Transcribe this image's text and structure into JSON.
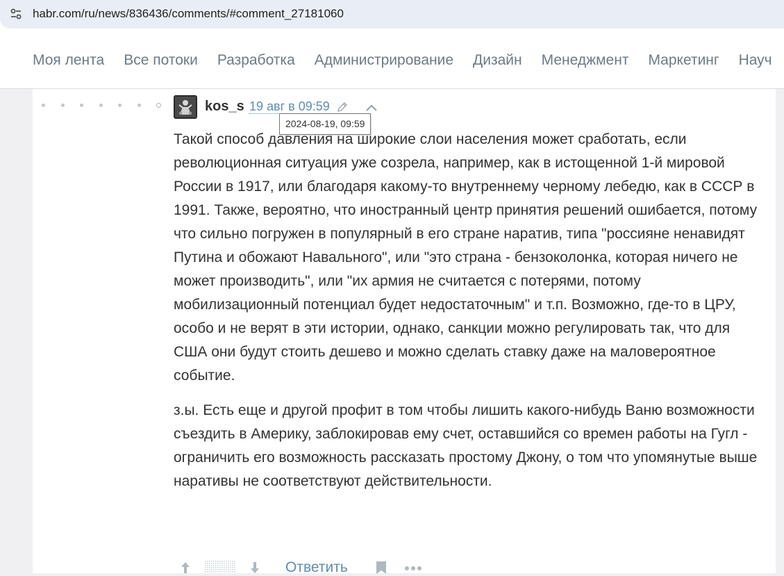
{
  "browser": {
    "url": "habr.com/ru/news/836436/comments/#comment_27181060",
    "site_info_icon": "tune-icon"
  },
  "nav": {
    "items": [
      {
        "label": "Моя лента"
      },
      {
        "label": "Все потоки"
      },
      {
        "label": "Разработка"
      },
      {
        "label": "Администрирование"
      },
      {
        "label": "Дизайн"
      },
      {
        "label": "Менеджмент"
      },
      {
        "label": "Маркетинг"
      },
      {
        "label": "Науч"
      }
    ]
  },
  "comment": {
    "thread_depth_dots": 7,
    "author": "kos_s",
    "time": "19 авг в 09:59",
    "tooltip": "2024-08-19, 09:59",
    "paragraphs": [
      "Такой способ давления на широкие слои населения может сработать, если революционная ситуация уже созрела, например, как в истощенной 1-й мировой России в 1917, или благодаря какому-то внутреннему черному лебедю, как в СССР в 1991. Также, вероятно, что иностранный центр принятия решений ошибается, потому что сильно погружен в популярный в его стране наратив, типа \"россияне ненавидят Путина и обожают Навального\", или \"это страна - бензоколонка, которая ничего не может производить\", или \"их армия не считается с потерями, потому мобилизационный потенциал будет недостаточным\" и т.п. Возможно, где-то в ЦРУ, особо и не верят в эти истории, однако, санкции можно регулировать так, что для США они будут стоить дешево и можно сделать ставку даже на маловероятное событие.",
      "з.ы. Есть еще и другой профит в том чтобы лишить какого-нибудь Ваню возможности съездить в Америку, заблокировав ему счет, оставшийся со времен работы на Гугл - ограничить его возможность рассказать простому Джону, о том что упомянутые выше наративы не соответствуют действительности."
    ],
    "reply_label": "Ответить"
  },
  "colors": {
    "link": "#5e8db3",
    "nav_text": "#6b7b85",
    "address_bar": "#e9eef6"
  }
}
